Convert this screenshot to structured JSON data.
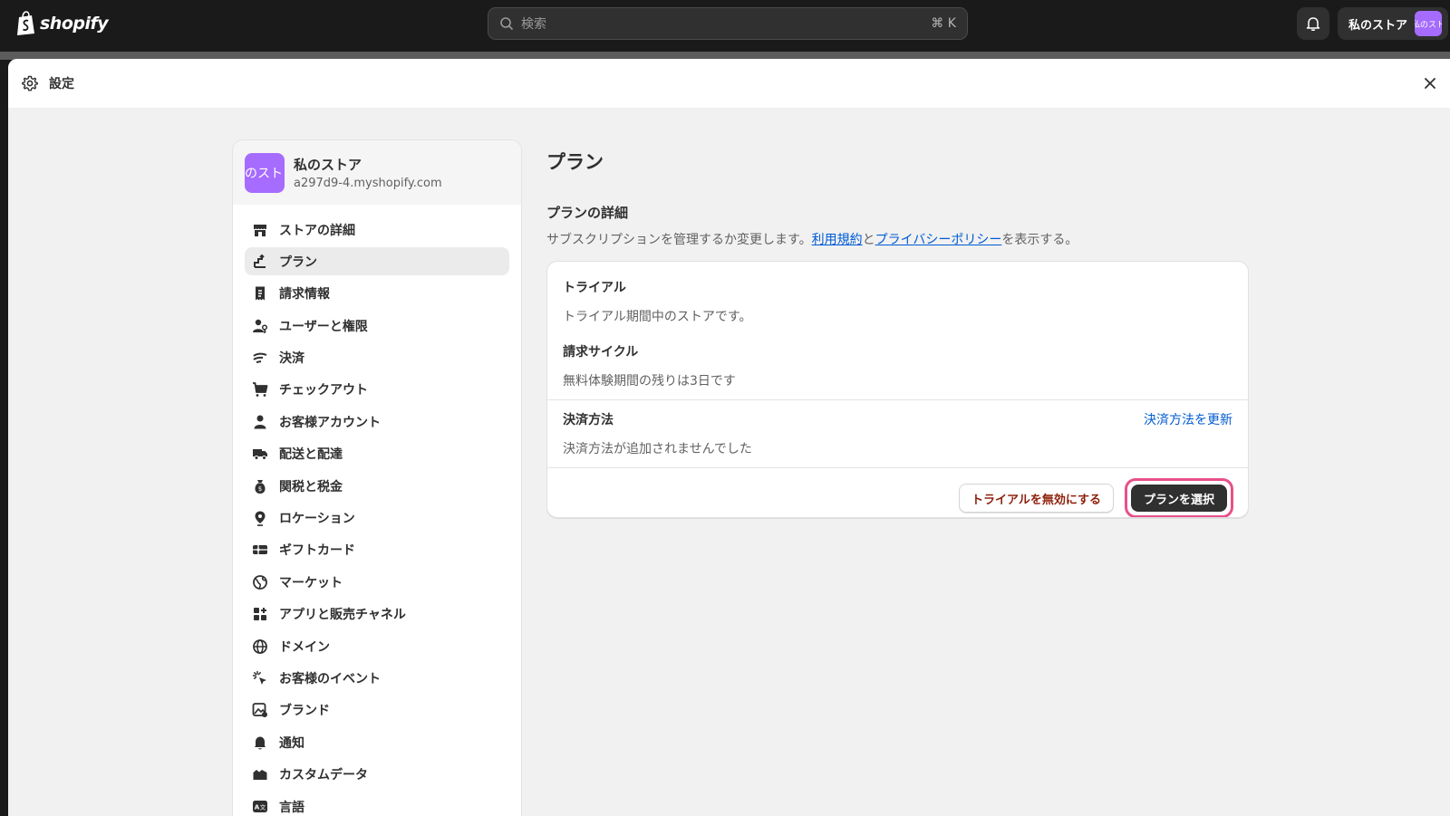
{
  "topbar": {
    "logo_text": "shopify",
    "search_placeholder": "検索",
    "search_shortcut": "⌘ K",
    "store_name": "私のストア",
    "store_avatar_text": "私のスト"
  },
  "modal": {
    "title": "設定"
  },
  "sidebar": {
    "store_avatar_text": "私のスト",
    "store_name": "私のストア",
    "store_domain": "a297d9-4.myshopify.com",
    "items": [
      {
        "label": "ストアの詳細",
        "icon": "store-icon"
      },
      {
        "label": "プラン",
        "icon": "plan-icon"
      },
      {
        "label": "請求情報",
        "icon": "receipt-icon"
      },
      {
        "label": "ユーザーと権限",
        "icon": "user-key-icon"
      },
      {
        "label": "決済",
        "icon": "payments-icon"
      },
      {
        "label": "チェックアウト",
        "icon": "cart-icon"
      },
      {
        "label": "お客様アカウント",
        "icon": "person-icon"
      },
      {
        "label": "配送と配達",
        "icon": "truck-icon"
      },
      {
        "label": "関税と税金",
        "icon": "money-bag-icon"
      },
      {
        "label": "ロケーション",
        "icon": "location-icon"
      },
      {
        "label": "ギフトカード",
        "icon": "gift-card-icon"
      },
      {
        "label": "マーケット",
        "icon": "globe-icon"
      },
      {
        "label": "アプリと販売チャネル",
        "icon": "apps-icon"
      },
      {
        "label": "ドメイン",
        "icon": "domain-globe-icon"
      },
      {
        "label": "お客様のイベント",
        "icon": "cursor-click-icon"
      },
      {
        "label": "ブランド",
        "icon": "brand-image-icon"
      },
      {
        "label": "通知",
        "icon": "bell-icon"
      },
      {
        "label": "カスタムデータ",
        "icon": "database-icon"
      },
      {
        "label": "言語",
        "icon": "language-icon"
      }
    ],
    "active_index": 1
  },
  "main": {
    "page_title": "プラン",
    "section_title": "プランの詳細",
    "desc_prefix": "サブスクリプションを管理するか変更します。",
    "terms_link": "利用規約",
    "desc_and": "と",
    "privacy_link": "プライバシーポリシー",
    "desc_suffix": "を表示する。",
    "card": {
      "trial_title": "トライアル",
      "trial_desc": "トライアル期間中のストアです。",
      "cycle_title": "請求サイクル",
      "cycle_desc": "無料体験期間の残りは3日です",
      "payment_title": "決済方法",
      "payment_update_link": "決済方法を更新",
      "payment_desc": "決済方法が追加されませんでした",
      "disable_trial_button": "トライアルを無効にする",
      "choose_plan_button": "プランを選択"
    }
  },
  "colors": {
    "topbar_bg": "#1a1a1a",
    "avatar_purple": "#a66bff",
    "link_blue": "#005bd3",
    "critical_text": "#8e1f0b",
    "highlight_pink": "#e8508a",
    "primary_button": "#303030"
  }
}
